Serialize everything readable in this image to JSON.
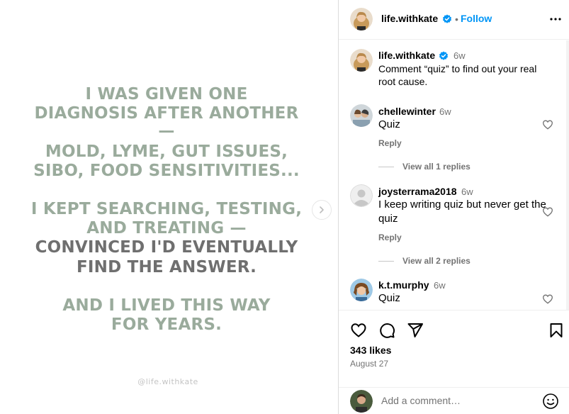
{
  "post_image": {
    "lines": [
      {
        "text": "I WAS GIVEN ONE",
        "tone": "green"
      },
      {
        "text": "DIAGNOSIS AFTER ANOTHER",
        "tone": "green"
      },
      {
        "text": "—",
        "tone": "green"
      },
      {
        "text": "MOLD, LYME, GUT ISSUES,",
        "tone": "green"
      },
      {
        "text": "SIBO, FOOD SENSITIVITIES...",
        "tone": "green"
      },
      {
        "text": "I KEPT SEARCHING, TESTING,",
        "tone": "green"
      },
      {
        "text": "AND TREATING —",
        "tone": "green"
      },
      {
        "text": "CONVINCED I'D EVENTUALLY",
        "tone": "dark"
      },
      {
        "text": "FIND THE ANSWER.",
        "tone": "dark"
      },
      {
        "text": "AND I LIVED THIS WAY",
        "tone": "green"
      },
      {
        "text": "FOR YEARS.",
        "tone": "green"
      }
    ],
    "watermark": "@life.withkate"
  },
  "header": {
    "username": "life.withkate",
    "separator": "•",
    "follow_label": "Follow"
  },
  "caption": {
    "username": "life.withkate",
    "time": "6w",
    "text": "Comment “quiz” to find out your real root cause."
  },
  "comments": [
    {
      "username": "chellewinter",
      "time": "6w",
      "text": "Quiz",
      "reply_label": "Reply",
      "view_replies": "View all 1 replies"
    },
    {
      "username": "joysterrama2018",
      "time": "6w",
      "text": "I keep writing quiz but never get the quiz",
      "reply_label": "Reply",
      "view_replies": "View all 2 replies"
    },
    {
      "username": "k.t.murphy",
      "time": "6w",
      "text": "Quiz"
    }
  ],
  "actions": {
    "likes": "343 likes",
    "date": "August 27"
  },
  "add_comment": {
    "placeholder": "Add a comment…"
  },
  "colors": {
    "accent": "#0095f6",
    "verified": "#0095f6",
    "image_green": "#9aab9c",
    "image_dark": "#6f6f6f"
  },
  "icons": [
    "chevron-right-icon",
    "verified-icon",
    "more-icon",
    "heart-icon",
    "comment-icon",
    "share-icon",
    "bookmark-icon",
    "emoji-icon"
  ]
}
